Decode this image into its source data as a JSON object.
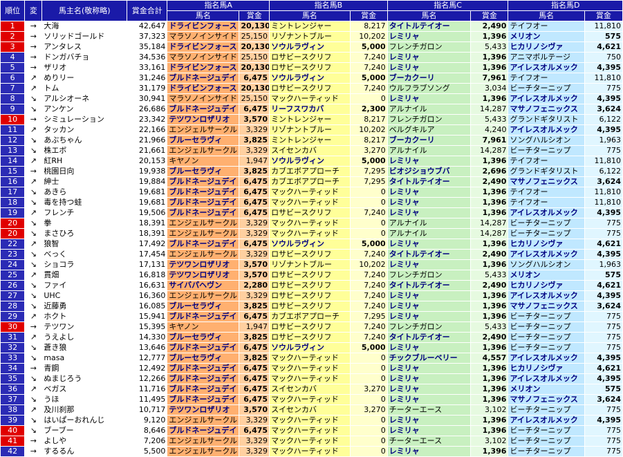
{
  "headers": {
    "rank": "順位",
    "change": "変",
    "owner": "馬主名(敬称略)",
    "total": "賞金合計",
    "groups": [
      "指名馬A",
      "指名馬B",
      "指名馬C",
      "指名馬D"
    ],
    "horse": "馬名",
    "prize": "賞金"
  },
  "colors": {
    "rank_default": "#2b2bb5",
    "rank_highlight": "#e00000"
  },
  "rows": [
    {
      "rank": "1",
      "red": true,
      "arrow": "→",
      "owner": "大海",
      "total": "42,647",
      "a": "ドライビンフォース",
      "av": "20,130",
      "ab": true,
      "b": "ミントレンジャー",
      "bv": "8,217",
      "bb": false,
      "c": "タイトルテイオー",
      "cv": "2,490",
      "cb": true,
      "d": "テイフオー",
      "dv": "11,810",
      "db": false
    },
    {
      "rank": "2",
      "red": true,
      "arrow": "→",
      "owner": "ソリッドゴールド",
      "total": "37,323",
      "a": "マラソノインサイド",
      "av": "25,150",
      "ab": false,
      "b": "リゾナントブルー",
      "bv": "10,202",
      "bb": false,
      "c": "レミリャ",
      "cv": "1,396",
      "cb": true,
      "d": "メリオン",
      "dv": "575",
      "db": true
    },
    {
      "rank": "3",
      "red": true,
      "arrow": "→",
      "owner": "アンタレス",
      "total": "35,184",
      "a": "ドライビンフォース",
      "av": "20,130",
      "ab": true,
      "b": "ソウルラヴィン",
      "bv": "5,000",
      "bb": true,
      "c": "フレンチガロン",
      "cv": "5,433",
      "cb": false,
      "d": "ヒカリノシヴァ",
      "dv": "4,621",
      "db": true
    },
    {
      "rank": "4",
      "red": false,
      "arrow": "→",
      "owner": "ドンガバチョ",
      "total": "34,536",
      "a": "マラソノインサイド",
      "av": "25,150",
      "ab": false,
      "b": "ロサビースクリフ",
      "bv": "7,240",
      "bb": false,
      "c": "レミリャ",
      "cv": "1,396",
      "cb": true,
      "d": "アニマボルテージ",
      "dv": "750",
      "db": false
    },
    {
      "rank": "5",
      "red": false,
      "arrow": "→",
      "owner": "ザリオ",
      "total": "33,161",
      "a": "ドライビンフォース",
      "av": "20,130",
      "ab": true,
      "b": "ロサビースクリフ",
      "bv": "7,240",
      "bb": false,
      "c": "レミリャ",
      "cv": "1,396",
      "cb": true,
      "d": "アイレスオルメック",
      "dv": "4,395",
      "db": true
    },
    {
      "rank": "6",
      "red": false,
      "arrow": "↗",
      "owner": "めりリー",
      "total": "31,246",
      "a": "ブルドネージュデイ",
      "av": "6,475",
      "ab": true,
      "b": "ソウルラヴィン",
      "bv": "5,000",
      "bb": true,
      "c": "ブーカクーリ",
      "cv": "7,961",
      "cb": true,
      "d": "テイフオー",
      "dv": "11,810",
      "db": false
    },
    {
      "rank": "7",
      "red": false,
      "arrow": "↗",
      "owner": "トム",
      "total": "31,179",
      "a": "ドライビンフォース",
      "av": "20,130",
      "ab": true,
      "b": "ロサビースクリフ",
      "bv": "7,240",
      "bb": false,
      "c": "ウルフラブソング",
      "cv": "3,034",
      "cb": false,
      "d": "ビーチターニップ",
      "dv": "775",
      "db": false
    },
    {
      "rank": "8",
      "red": false,
      "arrow": "↘",
      "owner": "アルシオーネ",
      "total": "30,941",
      "a": "マラソノインサイド",
      "av": "25,150",
      "ab": false,
      "b": "マックハーティッド",
      "bv": "0",
      "bb": false,
      "c": "レミリャ",
      "cv": "1,396",
      "cb": true,
      "d": "アイレスオルメック",
      "dv": "4,395",
      "db": true
    },
    {
      "rank": "9",
      "red": false,
      "arrow": "↘",
      "owner": "アンケン",
      "total": "26,686",
      "a": "ブルドネージュデイ",
      "av": "6,475",
      "ab": true,
      "b": "リーフスワカバ",
      "bv": "2,300",
      "bb": true,
      "c": "アルナイル",
      "cv": "14,287",
      "cb": false,
      "d": "マサノフェニックス",
      "dv": "3,624",
      "db": true
    },
    {
      "rank": "10",
      "red": true,
      "arrow": "→",
      "owner": "シミュレーション",
      "total": "23,342",
      "a": "テツワンロザリオ",
      "av": "3,570",
      "ab": true,
      "b": "ミントレンジャー",
      "bv": "8,217",
      "bb": false,
      "c": "フレンチガロン",
      "cv": "5,433",
      "cb": false,
      "d": "グランドギタリスト",
      "dv": "6,122",
      "db": false
    },
    {
      "rank": "11",
      "red": false,
      "arrow": "↗",
      "owner": "タッカン",
      "total": "22,166",
      "a": "エンジェルサークル",
      "av": "3,329",
      "ab": false,
      "b": "リゾナントブルー",
      "bv": "10,202",
      "bb": false,
      "c": "ベルグキルア",
      "cv": "4,240",
      "cb": false,
      "d": "アイレスオルメック",
      "dv": "4,395",
      "db": true
    },
    {
      "rank": "12",
      "red": false,
      "arrow": "↘",
      "owner": "あぶちゃん",
      "total": "21,966",
      "a": "ブルーセラヴィ",
      "av": "3,825",
      "ab": true,
      "b": "ミントレンジャー",
      "bv": "8,217",
      "bb": false,
      "c": "ブーカクーリ",
      "cv": "7,961",
      "cb": true,
      "d": "ソングハルシオン",
      "dv": "1,963",
      "db": false
    },
    {
      "rank": "13",
      "red": false,
      "arrow": "↘",
      "owner": "株エボ",
      "total": "21,661",
      "a": "エンジェルサークル",
      "av": "3,329",
      "ab": false,
      "b": "スイセンカバ",
      "bv": "3,270",
      "bb": false,
      "c": "アルナイル",
      "cv": "14,287",
      "cb": false,
      "d": "ビーチターニップ",
      "dv": "775",
      "db": false
    },
    {
      "rank": "14",
      "red": false,
      "arrow": "↗",
      "owner": "紅RH",
      "total": "20,153",
      "a": "キヤノン",
      "av": "1,947",
      "ab": false,
      "b": "ソウルラヴィン",
      "bv": "5,000",
      "bb": true,
      "c": "レミリャ",
      "cv": "1,396",
      "cb": true,
      "d": "テイフオー",
      "dv": "11,810",
      "db": false
    },
    {
      "rank": "15",
      "red": false,
      "arrow": "→",
      "owner": "桃園日向",
      "total": "19,938",
      "a": "ブルーセラヴィ",
      "av": "3,825",
      "ab": true,
      "b": "カブエボアプローチ",
      "bv": "7,295",
      "bb": false,
      "c": "ビオジショウブバ",
      "cv": "2,696",
      "cb": true,
      "d": "グランドギタリスト",
      "dv": "6,122",
      "db": false
    },
    {
      "rank": "16",
      "red": false,
      "arrow": "↗",
      "owner": "紳士",
      "total": "19,884",
      "a": "ブルドネージュデイ",
      "av": "6,475",
      "ab": true,
      "b": "カブエボアプローチ",
      "bv": "7,295",
      "bb": false,
      "c": "タイトルテイオー",
      "cv": "2,490",
      "cb": true,
      "d": "マサノフェニックス",
      "dv": "3,624",
      "db": true
    },
    {
      "rank": "17",
      "red": false,
      "arrow": "↘",
      "owner": "あきら",
      "total": "19,681",
      "a": "ブルドネージュデイ",
      "av": "6,475",
      "ab": true,
      "b": "マックハーティッド",
      "bv": "0",
      "bb": false,
      "c": "レミリャ",
      "cv": "1,396",
      "cb": true,
      "d": "テイフオー",
      "dv": "11,810",
      "db": false
    },
    {
      "rank": "18",
      "red": false,
      "arrow": "↘",
      "owner": "毒を持つ蛙",
      "total": "19,681",
      "a": "ブルドネージュデイ",
      "av": "6,475",
      "ab": true,
      "b": "マックハーティッド",
      "bv": "0",
      "bb": false,
      "c": "レミリャ",
      "cv": "1,396",
      "cb": true,
      "d": "テイフオー",
      "dv": "11,810",
      "db": false
    },
    {
      "rank": "19",
      "red": false,
      "arrow": "↗",
      "owner": "フレンチ",
      "total": "19,506",
      "a": "ブルドネージュデイ",
      "av": "6,475",
      "ab": true,
      "b": "ロサビースクリフ",
      "bv": "7,240",
      "bb": false,
      "c": "レミリャ",
      "cv": "1,396",
      "cb": true,
      "d": "アイレスオルメック",
      "dv": "4,395",
      "db": true
    },
    {
      "rank": "20",
      "red": true,
      "arrow": "↘",
      "owner": "拳",
      "total": "18,391",
      "a": "エンジェルサークル",
      "av": "3,329",
      "ab": false,
      "b": "マックハーティッド",
      "bv": "0",
      "bb": false,
      "c": "アルナイル",
      "cv": "14,287",
      "cb": false,
      "d": "ビーチターニップ",
      "dv": "775",
      "db": false
    },
    {
      "rank": "20",
      "red": true,
      "arrow": "↘",
      "owner": "まさひろ",
      "total": "18,391",
      "a": "エンジェルサークル",
      "av": "3,329",
      "ab": false,
      "b": "マックハーティッド",
      "bv": "0",
      "bb": false,
      "c": "アルナイル",
      "cv": "14,287",
      "cb": false,
      "d": "ビーチターニップ",
      "dv": "775",
      "db": false
    },
    {
      "rank": "22",
      "red": false,
      "arrow": "↗",
      "owner": "狼智",
      "total": "17,492",
      "a": "ブルドネージュデイ",
      "av": "6,475",
      "ab": true,
      "b": "ソウルラヴィン",
      "bv": "5,000",
      "bb": true,
      "c": "レミリャ",
      "cv": "1,396",
      "cb": true,
      "d": "ヒカリノシヴァ",
      "dv": "4,621",
      "db": true
    },
    {
      "rank": "23",
      "red": false,
      "arrow": "↘",
      "owner": "べっく",
      "total": "17,454",
      "a": "エンジェルサークル",
      "av": "3,329",
      "ab": false,
      "b": "ロサビースクリフ",
      "bv": "7,240",
      "bb": false,
      "c": "タイトルテイオー",
      "cv": "2,490",
      "cb": true,
      "d": "アイレスオルメック",
      "dv": "4,395",
      "db": true
    },
    {
      "rank": "24",
      "red": false,
      "arrow": "↘",
      "owner": "ショコラ",
      "total": "17,131",
      "a": "テツワンロザリオ",
      "av": "3,570",
      "ab": true,
      "b": "リゾナントブルー",
      "bv": "10,202",
      "bb": false,
      "c": "レミリャ",
      "cv": "1,396",
      "cb": true,
      "d": "ソングハルシオン",
      "dv": "1,963",
      "db": false
    },
    {
      "rank": "25",
      "red": false,
      "arrow": "↗",
      "owner": "貫畑",
      "total": "16,818",
      "a": "テツワンロザリオ",
      "av": "3,570",
      "ab": true,
      "b": "ロサビースクリフ",
      "bv": "7,240",
      "bb": false,
      "c": "フレンチガロン",
      "cv": "5,433",
      "cb": false,
      "d": "メリオン",
      "dv": "575",
      "db": true
    },
    {
      "rank": "26",
      "red": false,
      "arrow": "↘",
      "owner": "ファイ",
      "total": "16,631",
      "a": "サイバパヘヴン",
      "av": "2,280",
      "ab": true,
      "b": "ロサビースクリフ",
      "bv": "7,240",
      "bb": false,
      "c": "タイトルテイオー",
      "cv": "2,490",
      "cb": true,
      "d": "ヒカリノシヴァ",
      "dv": "4,621",
      "db": true
    },
    {
      "rank": "27",
      "red": false,
      "arrow": "↘",
      "owner": "UHC",
      "total": "16,360",
      "a": "エンジェルサークル",
      "av": "3,329",
      "ab": false,
      "b": "ロサビースクリフ",
      "bv": "7,240",
      "bb": false,
      "c": "レミリャ",
      "cv": "1,396",
      "cb": true,
      "d": "アイレスオルメック",
      "dv": "4,395",
      "db": true
    },
    {
      "rank": "28",
      "red": false,
      "arrow": "↘",
      "owner": "近藤勇",
      "total": "16,085",
      "a": "ブルーセラヴィ",
      "av": "3,825",
      "ab": true,
      "b": "ロサビースクリフ",
      "bv": "7,240",
      "bb": false,
      "c": "レミリャ",
      "cv": "1,396",
      "cb": true,
      "d": "マサノフェニックス",
      "dv": "3,624",
      "db": true
    },
    {
      "rank": "29",
      "red": false,
      "arrow": "↗",
      "owner": "ホクト",
      "total": "15,941",
      "a": "ブルドネージュデイ",
      "av": "6,475",
      "ab": true,
      "b": "カブエボアプローチ",
      "bv": "7,295",
      "bb": false,
      "c": "レミリャ",
      "cv": "1,396",
      "cb": true,
      "d": "ビーチターニップ",
      "dv": "775",
      "db": false
    },
    {
      "rank": "30",
      "red": true,
      "arrow": "→",
      "owner": "テツワン",
      "total": "15,395",
      "a": "キヤノン",
      "av": "1,947",
      "ab": false,
      "b": "ロサビースクリフ",
      "bv": "7,240",
      "bb": false,
      "c": "フレンチガロン",
      "cv": "5,433",
      "cb": false,
      "d": "ビーチターニップ",
      "dv": "775",
      "db": false
    },
    {
      "rank": "31",
      "red": false,
      "arrow": "↗",
      "owner": "うえよし",
      "total": "14,330",
      "a": "ブルーセラヴィ",
      "av": "3,825",
      "ab": true,
      "b": "ロサビースクリフ",
      "bv": "7,240",
      "bb": false,
      "c": "タイトルテイオー",
      "cv": "2,490",
      "cb": true,
      "d": "ビーチターニップ",
      "dv": "775",
      "db": false
    },
    {
      "rank": "32",
      "red": false,
      "arrow": "↘",
      "owner": "蒼き狼",
      "total": "13,646",
      "a": "ブルドネージュデイ",
      "av": "6,475",
      "ab": true,
      "b": "ソウルラヴィン",
      "bv": "5,000",
      "bb": true,
      "c": "レミリャ",
      "cv": "1,396",
      "cb": true,
      "d": "ビーチターニップ",
      "dv": "775",
      "db": false
    },
    {
      "rank": "33",
      "red": false,
      "arrow": "↘",
      "owner": "masa",
      "total": "12,777",
      "a": "ブルーセラヴィ",
      "av": "3,825",
      "ab": true,
      "b": "マックハーティッド",
      "bv": "0",
      "bb": false,
      "c": "チックブルーベリー",
      "cv": "4,557",
      "cb": true,
      "d": "アイレスオルメック",
      "dv": "4,395",
      "db": true
    },
    {
      "rank": "34",
      "red": false,
      "arrow": "→",
      "owner": "青鋼",
      "total": "12,492",
      "a": "ブルドネージュデイ",
      "av": "6,475",
      "ab": true,
      "b": "マックハーティッド",
      "bv": "0",
      "bb": false,
      "c": "レミリャ",
      "cv": "1,396",
      "cb": true,
      "d": "ヒカリノシヴァ",
      "dv": "4,621",
      "db": true
    },
    {
      "rank": "35",
      "red": false,
      "arrow": "↘",
      "owner": "ぬまじろう",
      "total": "12,266",
      "a": "ブルドネージュデイ",
      "av": "6,475",
      "ab": true,
      "b": "マックハーティッド",
      "bv": "0",
      "bb": false,
      "c": "レミリャ",
      "cv": "1,396",
      "cb": true,
      "d": "アイレスオルメック",
      "dv": "4,395",
      "db": true
    },
    {
      "rank": "36",
      "red": false,
      "arrow": "↗",
      "owner": "ベガス",
      "total": "11,716",
      "a": "ブルドネージュデイ",
      "av": "6,475",
      "ab": true,
      "b": "スイセンカバ",
      "bv": "3,270",
      "bb": false,
      "c": "レミリャ",
      "cv": "1,396",
      "cb": true,
      "d": "メリオン",
      "dv": "575",
      "db": true
    },
    {
      "rank": "37",
      "red": false,
      "arrow": "↘",
      "owner": "うほ",
      "total": "11,495",
      "a": "ブルドネージュデイ",
      "av": "6,475",
      "ab": true,
      "b": "マックハーティッド",
      "bv": "0",
      "bb": false,
      "c": "レミリャ",
      "cv": "1,396",
      "cb": true,
      "d": "マサノフェニックス",
      "dv": "3,624",
      "db": true
    },
    {
      "rank": "38",
      "red": false,
      "arrow": "↗",
      "owner": "及川刹那",
      "total": "10,717",
      "a": "テツワンロザリオ",
      "av": "3,570",
      "ab": true,
      "b": "スイセンカバ",
      "bv": "3,270",
      "bb": false,
      "c": "チーターエース",
      "cv": "3,102",
      "cb": false,
      "d": "ビーチターニップ",
      "dv": "775",
      "db": false
    },
    {
      "rank": "39",
      "red": false,
      "arrow": "↘",
      "owner": "はいぱーおれんじ",
      "total": "9,120",
      "a": "エンジェルサークル",
      "av": "3,329",
      "ab": false,
      "b": "マックハーティッド",
      "bv": "0",
      "bb": false,
      "c": "レミリャ",
      "cv": "1,396",
      "cb": true,
      "d": "アイレスオルメック",
      "dv": "4,395",
      "db": true
    },
    {
      "rank": "40",
      "red": true,
      "arrow": "↘",
      "owner": "ブーブー",
      "total": "8,646",
      "a": "ブルドネージュデイ",
      "av": "6,475",
      "ab": true,
      "b": "マックハーティッド",
      "bv": "0",
      "bb": false,
      "c": "レミリャ",
      "cv": "1,396",
      "cb": true,
      "d": "ビーチターニップ",
      "dv": "775",
      "db": false
    },
    {
      "rank": "41",
      "red": true,
      "arrow": "→",
      "owner": "よしや",
      "total": "7,206",
      "a": "エンジェルサークル",
      "av": "3,329",
      "ab": false,
      "b": "マックハーティッド",
      "bv": "0",
      "bb": false,
      "c": "チーターエース",
      "cv": "3,102",
      "cb": false,
      "d": "ビーチターニップ",
      "dv": "775",
      "db": false
    },
    {
      "rank": "42",
      "red": false,
      "arrow": "→",
      "owner": "するるん",
      "total": "5,500",
      "a": "エンジェルサークル",
      "av": "3,329",
      "ab": false,
      "b": "マックハーティッド",
      "bv": "0",
      "bb": false,
      "c": "レミリャ",
      "cv": "1,396",
      "cb": true,
      "d": "ビーチターニップ",
      "dv": "775",
      "db": false
    }
  ]
}
